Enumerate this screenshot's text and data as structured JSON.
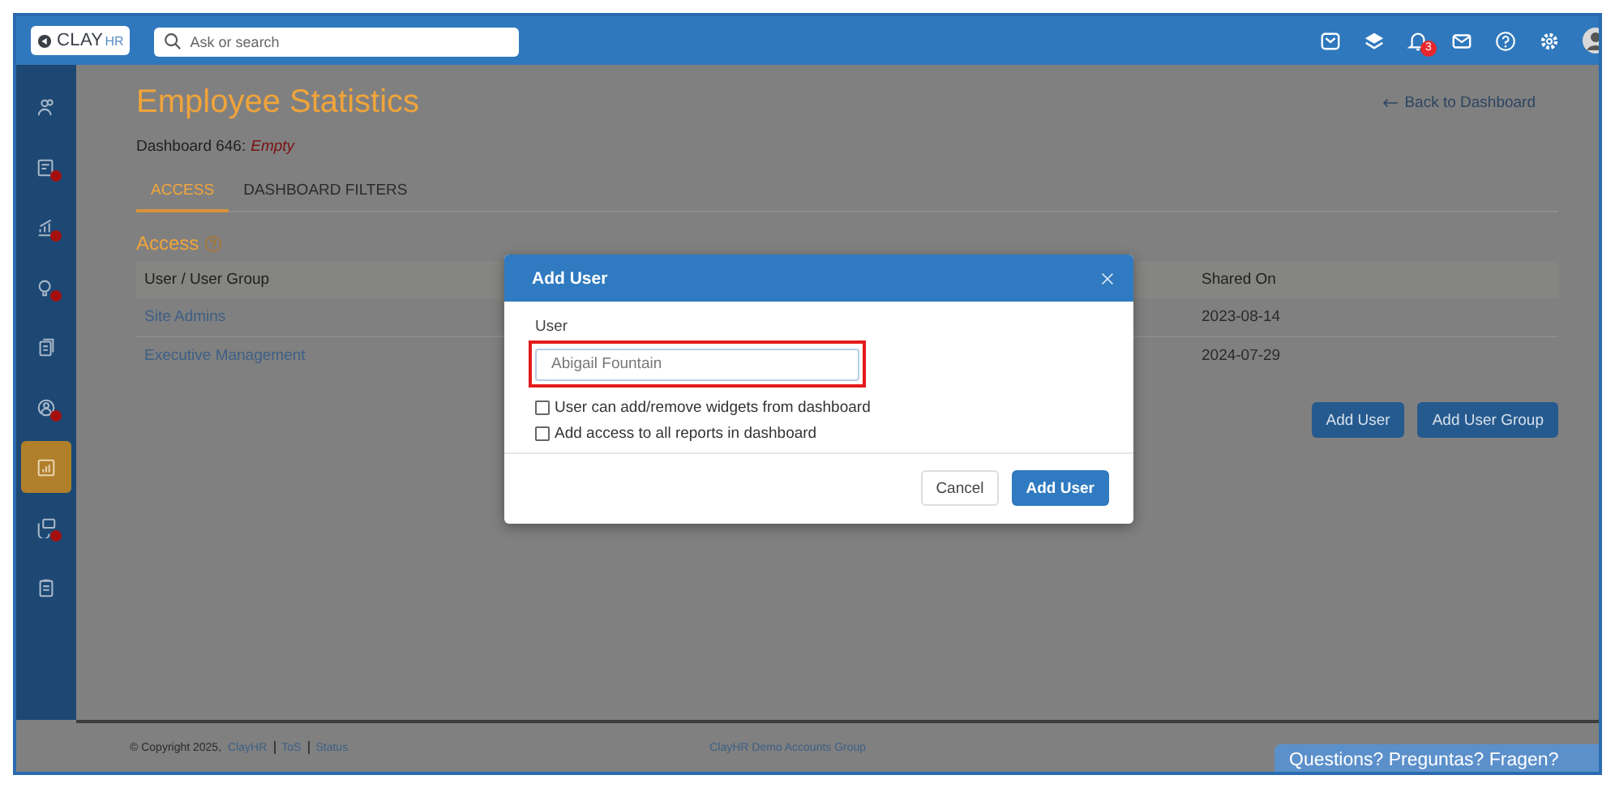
{
  "header": {
    "logo": {
      "brand": "CLAY",
      "suffix": "HR"
    },
    "search": {
      "placeholder": "Ask or search"
    },
    "icons": [
      {
        "kind": "tray"
      },
      {
        "kind": "layers"
      },
      {
        "kind": "bell",
        "badge": "3"
      },
      {
        "kind": "mail"
      },
      {
        "kind": "help"
      },
      {
        "kind": "settings"
      },
      {
        "kind": "avatar"
      }
    ]
  },
  "sidebar": {
    "items": [
      {
        "kind": "people",
        "alert": false,
        "selected": false
      },
      {
        "kind": "card",
        "alert": true,
        "selected": false
      },
      {
        "kind": "chart",
        "alert": true,
        "selected": false
      },
      {
        "kind": "bulb",
        "alert": true,
        "selected": false
      },
      {
        "kind": "docs",
        "alert": false,
        "selected": false
      },
      {
        "kind": "person",
        "alert": true,
        "selected": false
      },
      {
        "kind": "report",
        "alert": false,
        "selected": true
      },
      {
        "kind": "chat",
        "alert": true,
        "selected": false
      },
      {
        "kind": "clipboard",
        "alert": false,
        "selected": false
      }
    ]
  },
  "page": {
    "title": "Employee Statistics",
    "back_link": "Back to Dashboard",
    "dashboard_label": "Dashboard 646:",
    "dashboard_status": "Empty"
  },
  "tabs": [
    {
      "label": "ACCESS",
      "selected": true
    },
    {
      "label": "DASHBOARD FILTERS",
      "selected": false
    }
  ],
  "access": {
    "heading": "Access",
    "table": {
      "columns": [
        "User / User Group",
        "Shared On"
      ],
      "rows": [
        {
          "name": "Site Admins",
          "shared_on": "2023-08-14"
        },
        {
          "name": "Executive Management",
          "shared_on": "2024-07-29"
        }
      ]
    },
    "buttons": [
      "Add User",
      "Add User Group"
    ]
  },
  "footer": {
    "copyright": "© Copyright 2025,",
    "links": [
      "ClayHR",
      "ToS",
      "Status"
    ],
    "center": "ClayHR Demo Accounts Group"
  },
  "chat_tab": "Questions? Preguntas? Fragen?",
  "modal": {
    "title": "Add User",
    "field": {
      "label": "User",
      "value": "Abigail Fountain",
      "highlighted": true
    },
    "options": [
      {
        "label": "User can add/remove widgets from dashboard",
        "checked": false
      },
      {
        "label": "Add access to all reports in dashboard",
        "checked": false
      }
    ],
    "buttons": [
      {
        "label": "Cancel",
        "kind": "secondary"
      },
      {
        "label": "Add User",
        "kind": "primary"
      }
    ]
  }
}
